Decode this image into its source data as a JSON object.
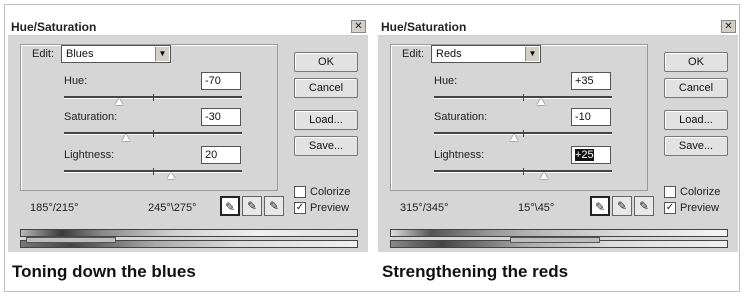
{
  "panels": [
    {
      "title": "Hue/Saturation",
      "close": "✕",
      "edit_label": "Edit:",
      "edit_value": "Blues",
      "hue_label": "Hue:",
      "hue_value": "-70",
      "hue_level": 0.31,
      "sat_label": "Saturation:",
      "sat_value": "-30",
      "sat_level": 0.35,
      "light_label": "Lightness:",
      "light_value": "20",
      "light_level": 0.6,
      "ok": "OK",
      "cancel": "Cancel",
      "load": "Load...",
      "save": "Save...",
      "colorize": "Colorize",
      "preview": "Preview",
      "range_left": "185°/215°",
      "range_right": "245°\\275°",
      "caption": "Toning down the blues"
    },
    {
      "title": "Hue/Saturation",
      "close": "✕",
      "edit_label": "Edit:",
      "edit_value": "Reds",
      "hue_label": "Hue:",
      "hue_value": "+35",
      "hue_level": 0.6,
      "sat_label": "Saturation:",
      "sat_value": "-10",
      "sat_level": 0.45,
      "light_label": "Lightness:",
      "light_value": "+25",
      "light_level": 0.62,
      "ok": "OK",
      "cancel": "Cancel",
      "load": "Load...",
      "save": "Save...",
      "colorize": "Colorize",
      "preview": "Preview",
      "range_left": "315°/345°",
      "range_right": "15°\\45°",
      "caption": "Strengthening the reds"
    }
  ]
}
